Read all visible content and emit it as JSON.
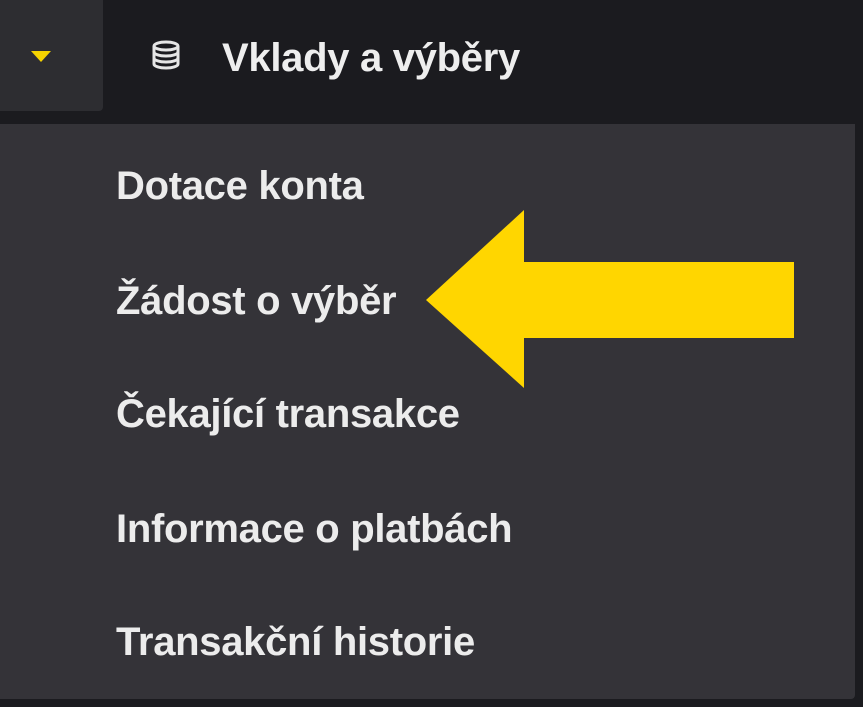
{
  "header": {
    "title": "Vklady a výběry",
    "toggle_icon": "caret-down-icon",
    "title_icon": "coins-icon"
  },
  "menu": {
    "items": [
      {
        "label": "Dotace konta"
      },
      {
        "label": "Žádost o výběr"
      },
      {
        "label": "Čekající transakce"
      },
      {
        "label": "Informace o platbách"
      },
      {
        "label": "Transakční historie"
      }
    ]
  },
  "annotation": {
    "icon": "arrow-left-icon",
    "color": "#ffd600"
  },
  "colors": {
    "accent": "#f5d300",
    "header_bg": "#1b1b1f",
    "menu_bg": "#343338",
    "text": "#ececec"
  }
}
